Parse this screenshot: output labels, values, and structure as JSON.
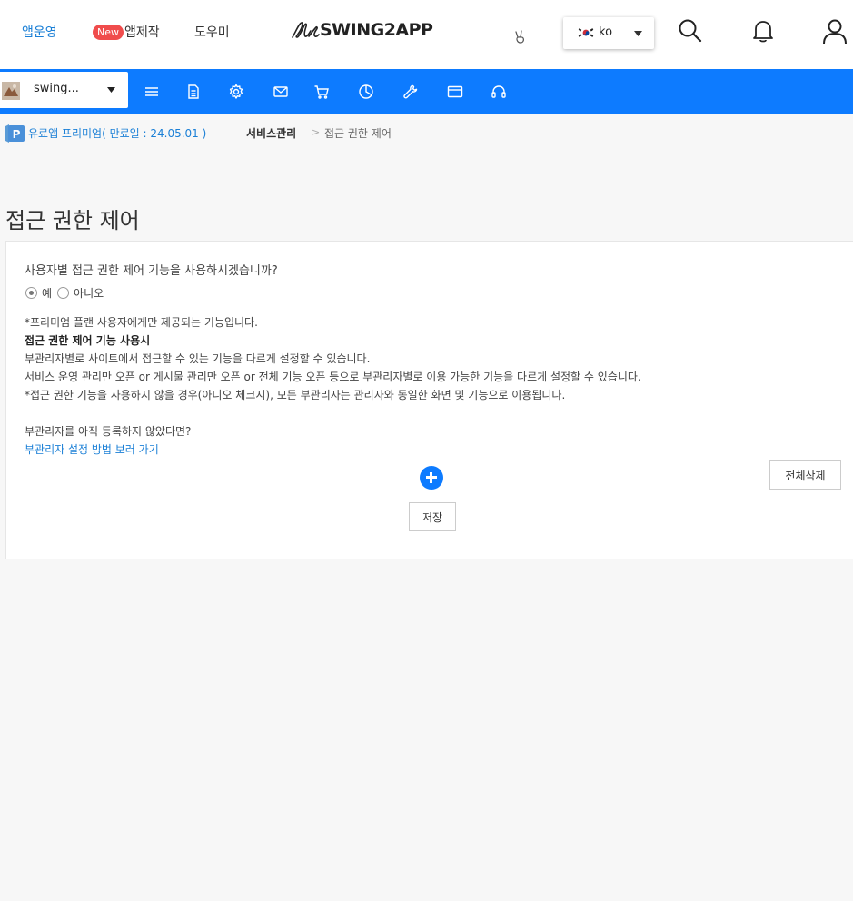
{
  "header": {
    "nav": {
      "app_manage": "앱운영",
      "new_badge": "New",
      "app_create": "앱제작",
      "help": "도우미"
    },
    "logo": "SWING2APP",
    "language": {
      "selected": "ko"
    },
    "icons": [
      "peace-hand-icon",
      "search-icon",
      "bell-icon",
      "user-icon"
    ]
  },
  "toolbar": {
    "app_name": "swing...",
    "icons": [
      "menu-icon",
      "document-icon",
      "gear-icon",
      "mail-icon",
      "cart-icon",
      "pie-chart-icon",
      "wrench-icon",
      "card-icon",
      "headset-icon"
    ],
    "accent": "#0d7bff"
  },
  "breadcrumb": {
    "plan_badge": "P",
    "plan_text": "유료앱 프리미엄( 만료일 : 24.05.01 )",
    "section": "서비스관리",
    "separator": ">",
    "current": "접근 권한 제어"
  },
  "page": {
    "title": "접근 권한 제어",
    "question": "사용자별 접근 권한 제어 기능을 사용하시겠습니까?",
    "options": {
      "yes": "예",
      "no": "아니오",
      "selected": "yes"
    },
    "notes": {
      "premium_only": "*프리미엄 플랜 사용자에게만 제공되는 기능입니다.",
      "heading": "접근 권한 제어 기능 사용시",
      "line1": "부관리자별로 사이트에서 접근할 수 있는 기능을 다르게 설정할 수 있습니다.",
      "line2": "서비스 운영 관리만 오픈 or 게시물 관리만 오픈 or 전체 기능 오픈 등으로 부관리자별로 이용 가능한 기능을 다르게 설정할 수 있습니다.",
      "line3": "*접근 권한 기능을 사용하지 않을 경우(아니오 체크시), 모든 부관리자는 관리자와 동일한 화면 및 기능으로 이용됩니다."
    },
    "sub_admin_question": "부관리자를 아직 등록하지 않았다면?",
    "sub_admin_link": "부관리자 설정 방법 보러 가기",
    "delete_all_label": "전체삭제",
    "save_label": "저장"
  }
}
